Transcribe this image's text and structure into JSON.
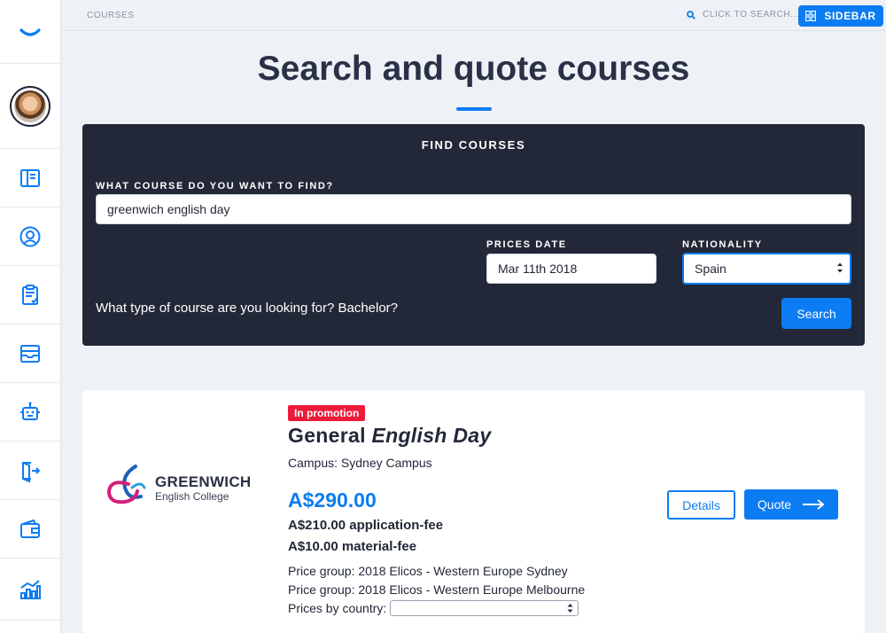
{
  "colors": {
    "accent": "#0c7cf2",
    "panel": "#232838",
    "promo": "#ee1a3a",
    "background": "#eef1f6"
  },
  "rail": {
    "logo_icon": "smile-logo-icon",
    "items": [
      {
        "icon": "layout-panel-icon"
      },
      {
        "icon": "user-circle-icon"
      },
      {
        "icon": "clipboard-check-icon"
      },
      {
        "icon": "inbox-tray-icon"
      },
      {
        "icon": "robot-icon"
      },
      {
        "icon": "exit-door-icon"
      },
      {
        "icon": "wallet-icon"
      },
      {
        "icon": "bar-chart-icon"
      }
    ]
  },
  "topbar": {
    "breadcrumb": "COURSES",
    "search_hint": "CLICK TO SEARCH...",
    "sidebar_label": "SIDEBAR"
  },
  "page": {
    "title": "Search and quote courses"
  },
  "find": {
    "heading": "FIND COURSES",
    "course_label": "WHAT COURSE DO YOU WANT TO FIND?",
    "course_value": "greenwich english day",
    "date_label": "PRICES DATE",
    "date_value": "Mar 11th 2018",
    "nationality_label": "NATIONALITY",
    "nationality_value": "Spain",
    "hint": "What type of course are you looking for? Bachelor?",
    "search_label": "Search"
  },
  "result": {
    "logo_name": "GREENWICH",
    "logo_sub": "English College",
    "badge": "In promotion",
    "course_name_plain": "General",
    "course_name_italic": "English Day",
    "campus": "Campus: Sydney Campus",
    "price": "A$290.00",
    "fees": [
      "A$210.00 application-fee",
      "A$10.00 material-fee"
    ],
    "price_groups": [
      "Price group: 2018 Elicos - Western Europe Sydney",
      "Price group: 2018 Elicos - Western Europe Melbourne"
    ],
    "prices_by_country_label": "Prices by country:",
    "details_label": "Details",
    "quote_label": "Quote"
  }
}
